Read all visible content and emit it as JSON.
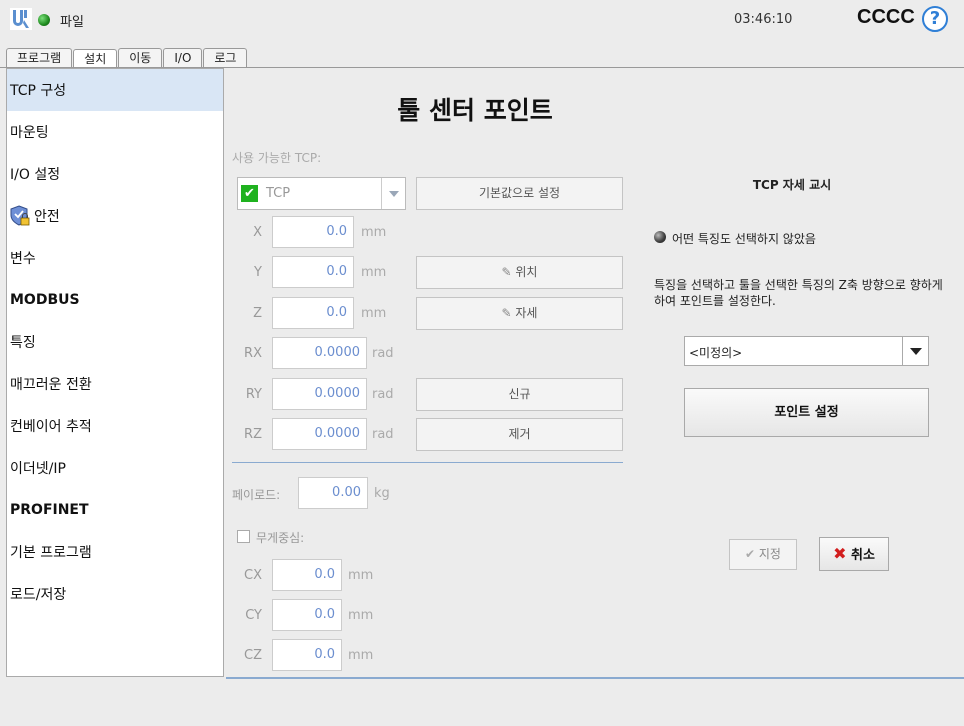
{
  "header": {
    "file_label": "파일",
    "clock": "03:46:10",
    "robot_name": "CCCC",
    "help_label": "?"
  },
  "tabs": [
    {
      "label": "프로그램",
      "active": false
    },
    {
      "label": "설치",
      "active": true
    },
    {
      "label": "이동",
      "active": false
    },
    {
      "label": "I/O",
      "active": false
    },
    {
      "label": "로그",
      "active": false
    }
  ],
  "sidebar": {
    "items": [
      {
        "label": "TCP 구성"
      },
      {
        "label": "마운팅"
      },
      {
        "label": "I/O 설정"
      },
      {
        "label": "안전"
      },
      {
        "label": "변수"
      },
      {
        "label": "MODBUS"
      },
      {
        "label": "특징"
      },
      {
        "label": "매끄러운 전환"
      },
      {
        "label": "컨베이어 추적"
      },
      {
        "label": "이더넷/IP"
      },
      {
        "label": "PROFINET"
      },
      {
        "label": "기본 프로그램"
      },
      {
        "label": "로드/저장"
      }
    ]
  },
  "main": {
    "title": "툴 센터 포인트",
    "available_tcp_label": "사용 가능한 TCP:",
    "tcp_selected": "TCP",
    "set_default_label": "기본값으로 설정",
    "position_button": "위치",
    "orientation_button": "자세",
    "new_button": "신규",
    "remove_button": "제거",
    "coords": {
      "x": {
        "label": "X",
        "value": "0.0",
        "unit": "mm"
      },
      "y": {
        "label": "Y",
        "value": "0.0",
        "unit": "mm"
      },
      "z": {
        "label": "Z",
        "value": "0.0",
        "unit": "mm"
      },
      "rx": {
        "label": "RX",
        "value": "0.0000",
        "unit": "rad"
      },
      "ry": {
        "label": "RY",
        "value": "0.0000",
        "unit": "rad"
      },
      "rz": {
        "label": "RZ",
        "value": "0.0000",
        "unit": "rad"
      }
    },
    "payload_label": "페이로드:",
    "payload_value": "0.00",
    "payload_unit": "kg",
    "cog_label": "무게중심:",
    "cog": {
      "cx": {
        "label": "CX",
        "value": "0.0",
        "unit": "mm"
      },
      "cy": {
        "label": "CY",
        "value": "0.0",
        "unit": "mm"
      },
      "cz": {
        "label": "CZ",
        "value": "0.0",
        "unit": "mm"
      }
    }
  },
  "teach": {
    "title": "TCP 자세 교시",
    "no_feature": "어떤 특징도 선택하지 않았음",
    "description": "특징을 선택하고 툴을 선택한 특징의 Z축 방향으로 향하게 하여 포인트를 설정한다.",
    "feature_value": "<미정의>",
    "set_point_button": "포인트 설정",
    "assign_button": "지정",
    "cancel_button": "취소"
  },
  "colors": {
    "accent_blue": "#2f7fd6",
    "sidebar_active": "#d9e6f5",
    "check_green": "#1fb21f",
    "cancel_red": "#d21e1e"
  }
}
